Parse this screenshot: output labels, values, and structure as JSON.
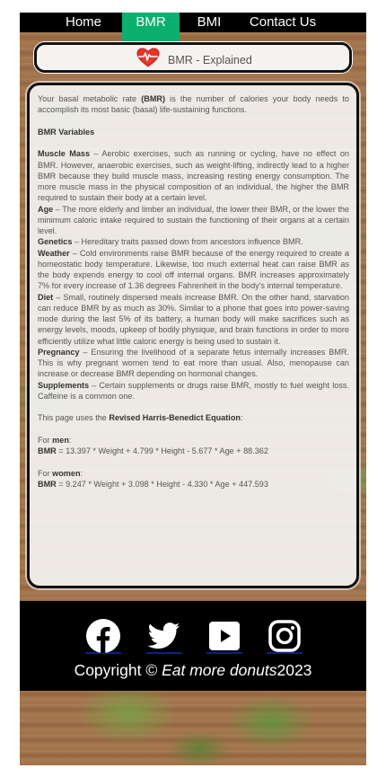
{
  "nav": {
    "items": [
      {
        "label": "Home",
        "active": false
      },
      {
        "label": "BMR",
        "active": true
      },
      {
        "label": "BMI",
        "active": false
      },
      {
        "label": "Contact Us",
        "active": false
      }
    ]
  },
  "header": {
    "icon": "heart-icon",
    "title": "BMR - Explained"
  },
  "content": {
    "intro_pre": "Your basal metabolic rate ",
    "intro_bold": "(BMR)",
    "intro_post": " is the number of calories your body needs to accomplish its most basic (basal) life-sustaining functions.",
    "variables_heading": "BMR Variables",
    "variables": [
      {
        "term": "Muscle Mass",
        "text": " – Aerobic exercises, such as running or cycling, have no effect on BMR. However, anaerobic exercises, such as weight-lifting, indirectly lead to a higher BMR because they build muscle mass, increasing resting energy consumption. The more muscle mass in the physical composition of an individual, the higher the BMR required to sustain their body at a certain level."
      },
      {
        "term": "Age",
        "text": " – The more elderly and limber an individual, the lower their BMR, or the lower the minimum caloric intake required to sustain the functioning of their organs at a certain level."
      },
      {
        "term": "Genetics",
        "text": " – Hereditary traits passed down from ancestors influence BMR."
      },
      {
        "term": "Weather",
        "text": " – Cold environments raise BMR because of the energy required to create a homeostatic body temperature. Likewise, too much external heat can raise BMR as the body expends energy to cool off internal organs. BMR increases approximately 7% for every increase of 1.36 degrees Fahrenheit in the body's internal temperature."
      },
      {
        "term": "Diet",
        "text": " – Small, routinely dispersed meals increase BMR. On the other hand, starvation can reduce BMR by as much as 30%. Similar to a phone that goes into power-saving mode during the last 5% of its battery, a human body will make sacrifices such as energy levels, moods, upkeep of bodily physique, and brain functions in order to more efficiently utilize what little caloric energy is being used to sustain it."
      },
      {
        "term": "Pregnancy",
        "text": " – Ensuring the livelihood of a separate fetus internally increases BMR. This is why pregnant women tend to eat more than usual. Also, menopause can increase or decrease BMR depending on hormonal changes."
      },
      {
        "term": "Supplements",
        "text": " – Certain supplements or drugs raise BMR, mostly to fuel weight loss. Caffeine is a common one."
      }
    ],
    "equation_pre": "This page uses the ",
    "equation_bold": "Revised Harris-Benedict Equation",
    "equation_post": ":",
    "men_pre": "For ",
    "men_bold": "men",
    "men_post": ":",
    "men_formula_label": "BMR",
    "men_formula": " = 13.397 * Weight + 4.799 * Height - 5.677 * Age + 88.362",
    "women_pre": "For ",
    "women_bold": "women",
    "women_post": ":",
    "women_formula_label": "BMR",
    "women_formula": " = 9.247 * Weight + 3.098 * Height - 4.330 * Age + 447.593"
  },
  "footer": {
    "social": [
      "facebook-icon",
      "twitter-icon",
      "youtube-icon",
      "instagram-icon"
    ],
    "copyright_pre": "Copyright © ",
    "copyright_brand": "Eat more donuts",
    "copyright_year": "2023"
  },
  "colors": {
    "nav_bg": "#000000",
    "nav_active": "#0bb06f",
    "footer_bg": "#000000"
  }
}
